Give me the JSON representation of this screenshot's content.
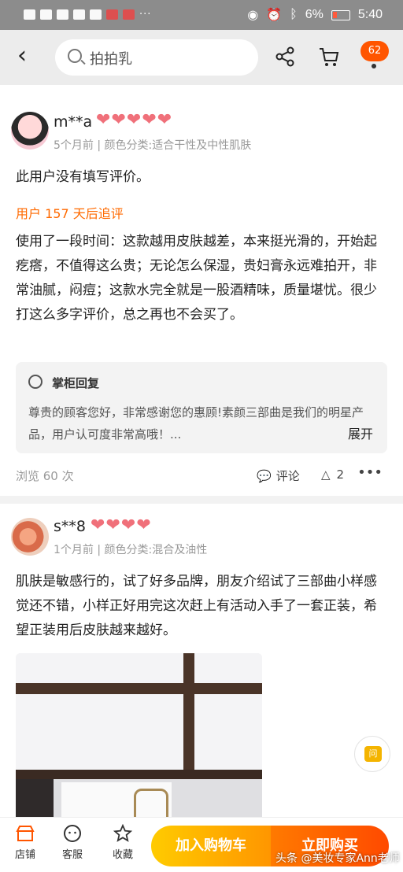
{
  "status_bar": {
    "battery": "6%",
    "time": "5:40"
  },
  "header": {
    "search_placeholder": "拍拍乳",
    "message_badge": "62"
  },
  "reviews": [
    {
      "username": "m**a",
      "hearts": 5,
      "meta": "5个月前 | 颜色分类:适合干性及中性肌肤",
      "text": "此用户没有填写评价。",
      "followup_label": "用户 157 天后追评",
      "followup_text": "使用了一段时间：这款越用皮肤越差，本来挺光滑的，开始起疙瘩，不值得这么贵；无论怎么保湿，贵妇膏永远难拍开，非常油腻，闷痘；这款水完全就是一股酒精味，质量堪忧。很少打这么多字评价，总之再也不会买了。",
      "reply_title": "掌柜回复",
      "reply_text": "尊贵的顾客您好，非常感谢您的惠顾!素颜三部曲是我们的明星产品，用户认可度非常高哦！...",
      "reply_expand": "展开",
      "views": "浏览 60 次",
      "comment_label": "评论",
      "likes": "2"
    },
    {
      "username": "s**8",
      "hearts": 4,
      "meta": "1个月前 | 颜色分类:混合及油性",
      "text": "肌肤是敏感行的，试了好多品牌，朋友介绍试了三部曲小样感觉还不错，小样正好用完这次赶上有活动入手了一套正装，希望正装用后皮肤越来越好。"
    }
  ],
  "float_button": {
    "label": "问"
  },
  "bottom_bar": {
    "shop": "店铺",
    "service": "客服",
    "favorite": "收藏",
    "add_to_cart": "加入购物车",
    "buy_now": "立即购买"
  },
  "watermark": "头条 @美妆专家Ann老师"
}
